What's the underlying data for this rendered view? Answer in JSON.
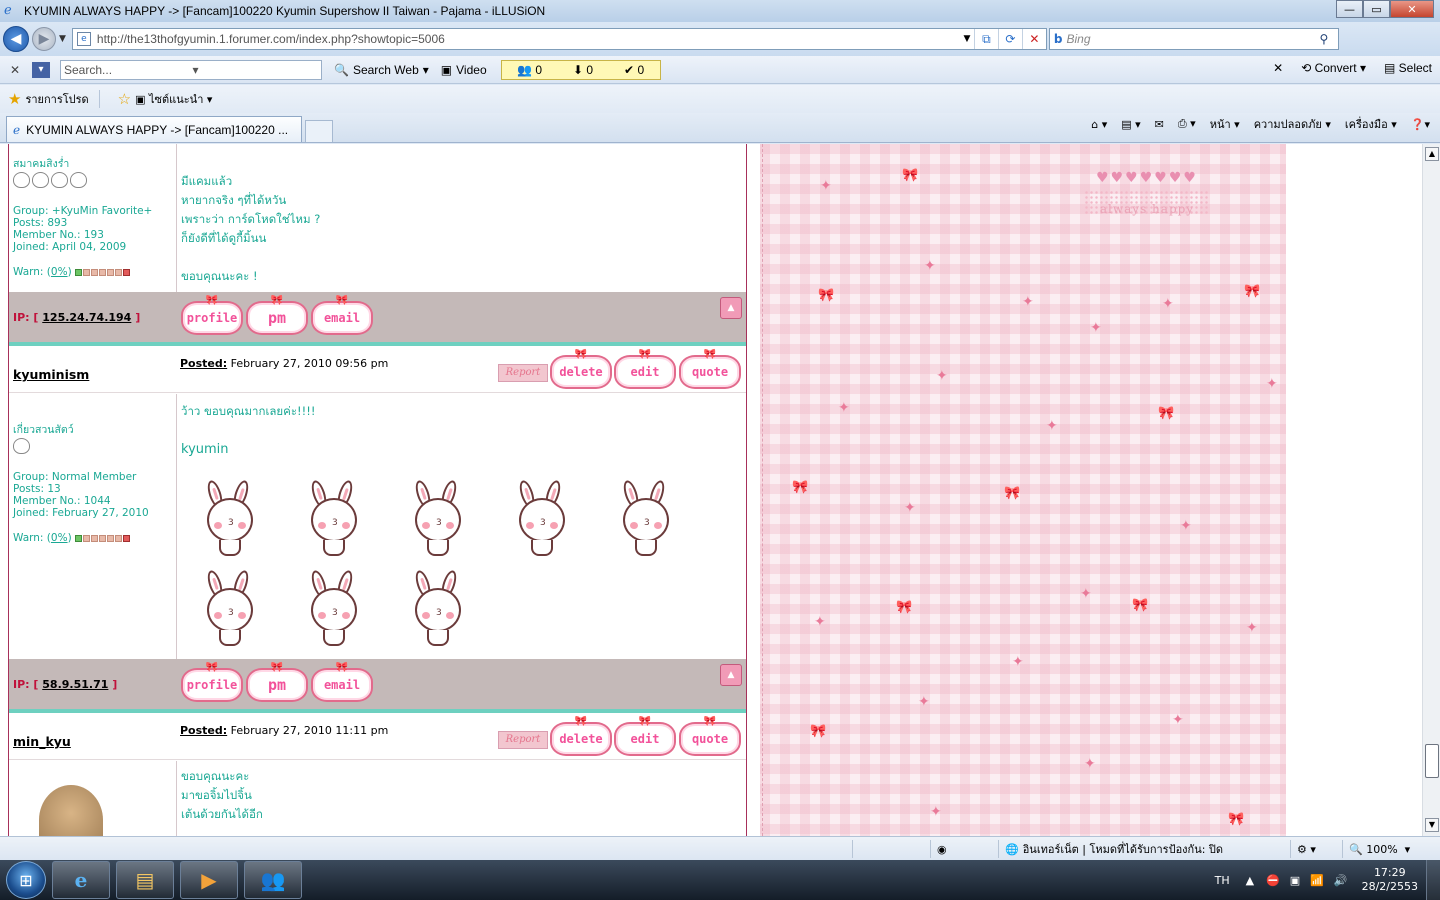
{
  "window": {
    "title": "KYUMIN ALWAYS HAPPY -> [Fancam]100220 Kyumin Supershow II Taiwan - Pajama - iLLUSiON"
  },
  "address": {
    "url": "http://the13thofgyumin.1.forumer.com/index.php?showtopic=5006",
    "search_placeholder": "Bing"
  },
  "toolbar": {
    "search_placeholder": "Search...",
    "search_web": "Search Web",
    "video": "Video",
    "counter1": "0",
    "counter2": "0",
    "counter3": "0",
    "convert": "Convert",
    "select": "Select"
  },
  "favorites": {
    "favorites_label": "รายการโปรด",
    "suggested_sites": "ไซต์แนะนำ"
  },
  "tabs": {
    "active_tab": "KYUMIN ALWAYS HAPPY -> [Fancam]100220 ...",
    "commands": [
      "หน้า",
      "ความปลอดภัย",
      "เครื่องมือ"
    ]
  },
  "posts": [
    {
      "rank_title": "สมาคมสิงร่ำ",
      "group": "Group: +KyuMin Favorite+",
      "posts": "Posts: 893",
      "member_no": "Member No.: 193",
      "joined": "Joined: April 04, 2009",
      "warn_prefix": "Warn: (",
      "warn_value": "0%",
      "warn_suffix": ")",
      "body": [
        "มีแคมแล้ว",
        "หายากจริง ๆที่ได้หวัน",
        "เพราะว่า การ์ดโหดใช่ไหม ?",
        "ก็ยังดีที่ได้ดูกี้มิ้นน",
        "",
        "ขอบคุณนะคะ !"
      ],
      "ip_label": "IP: [",
      "ip": "125.24.74.194",
      "ip_close": "]"
    },
    {
      "username": "kyuminism",
      "posted_label": "Posted:",
      "posted_date": "February 27, 2010 09:56 pm",
      "rank_title": "เกี่ยวสวนสัตว์",
      "group": "Group: Normal Member",
      "posts": "Posts: 13",
      "member_no": "Member No.: 1044",
      "joined": "Joined: February 27, 2010",
      "warn_prefix": "Warn: (",
      "warn_value": "0%",
      "warn_suffix": ")",
      "body_line1": "ว้าว ขอบคุณมากเลยค่ะ!!!!",
      "body_line2": "kyumin",
      "ip_label": "IP: [",
      "ip": "58.9.51.71",
      "ip_close": "]"
    },
    {
      "username": "min_kyu",
      "posted_label": "Posted:",
      "posted_date": "February 27, 2010 11:11 pm",
      "body": [
        "ขอบคุณนะคะ",
        "มาขอจิ้มไปจิ้น",
        "เต้นด้วยกันได้อีก"
      ]
    }
  ],
  "buttons": {
    "report": "Report",
    "delete": "delete",
    "edit": "edit",
    "quote": "quote",
    "profile": "profile",
    "pm": "pm",
    "email": "email"
  },
  "decoration": {
    "always_happy": "always happy"
  },
  "statusbar": {
    "zone": "อินเทอร์เน็ต | โหมดที่ได้รับการป้องกัน: ปิด",
    "zoom": "100%"
  },
  "taskbar": {
    "language": "TH",
    "time": "17:29",
    "date": "28/2/2553"
  }
}
